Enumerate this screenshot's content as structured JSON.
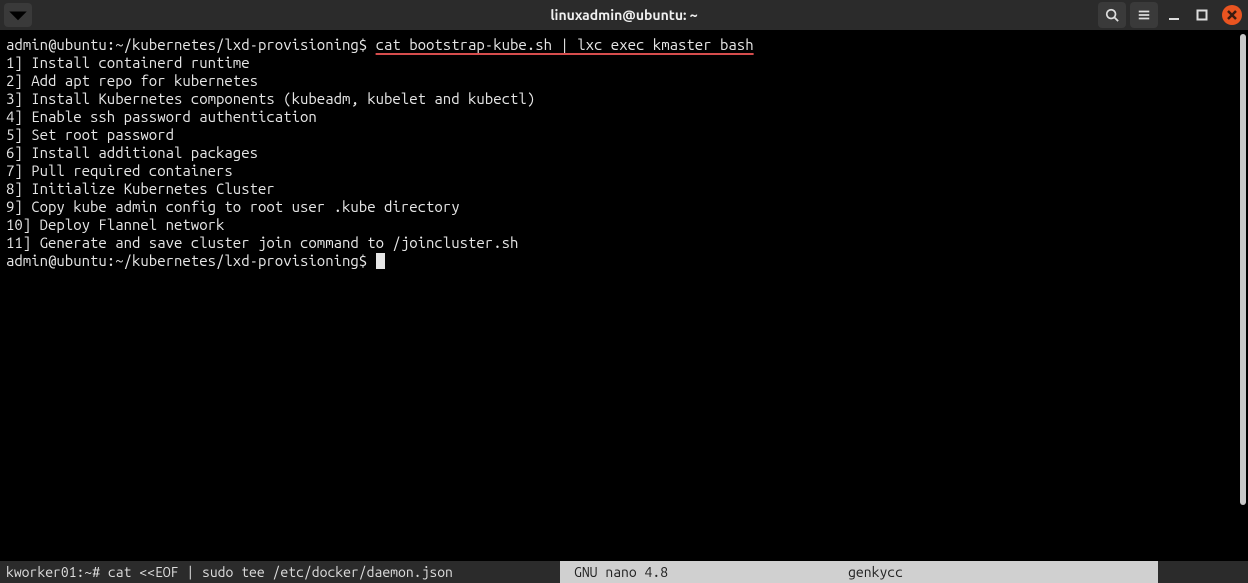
{
  "titlebar": {
    "title": "linuxadmin@ubuntu: ~"
  },
  "terminal": {
    "prompt1": "admin@ubuntu:~/kubernetes/lxd-provisioning$ ",
    "command1": "cat bootstrap-kube.sh | lxc exec kmaster bash",
    "lines": [
      "1] Install containerd runtime",
      "2] Add apt repo for kubernetes",
      "3] Install Kubernetes components (kubeadm, kubelet and kubectl)",
      "4] Enable ssh password authentication",
      "5] Set root password",
      "6] Install additional packages",
      "7] Pull required containers",
      "8] Initialize Kubernetes Cluster",
      "9] Copy kube admin config to root user .kube directory",
      "10] Deploy Flannel network",
      "11] Generate and save cluster join command to /joincluster.sh"
    ],
    "prompt2": "admin@ubuntu:~/kubernetes/lxd-provisioning$ "
  },
  "status": {
    "left": "kworker01:~# cat <<EOF | sudo tee /etc/docker/daemon.json",
    "mid1": "GNU nano 4.8",
    "mid2": "genkycc"
  }
}
